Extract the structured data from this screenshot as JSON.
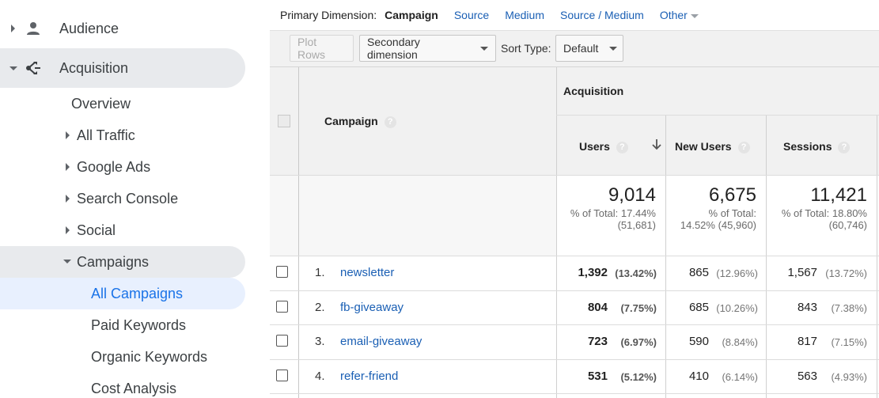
{
  "sidebar": {
    "audience": "Audience",
    "acquisition": "Acquisition",
    "overview": "Overview",
    "all_traffic": "All Traffic",
    "google_ads": "Google Ads",
    "search_console": "Search Console",
    "social": "Social",
    "campaigns": "Campaigns",
    "all_campaigns": "All Campaigns",
    "paid_keywords": "Paid Keywords",
    "organic_keywords": "Organic Keywords",
    "cost_analysis": "Cost Analysis"
  },
  "dimensions": {
    "label": "Primary Dimension:",
    "current": "Campaign",
    "source": "Source",
    "medium": "Medium",
    "source_medium": "Source / Medium",
    "other": "Other"
  },
  "toolbar": {
    "plot_rows": "Plot Rows",
    "secondary_dimension": "Secondary dimension",
    "sort_type_label": "Sort Type:",
    "sort_type_value": "Default"
  },
  "table": {
    "group_header": "Acquisition",
    "campaign_header": "Campaign",
    "columns": [
      "Users",
      "New Users",
      "Sessions"
    ],
    "help_glyph": "?",
    "totals": [
      {
        "value": "9,014",
        "pct_line1": "% of Total: 17.44%",
        "pct_line2": "(51,681)"
      },
      {
        "value": "6,675",
        "pct_line1": "% of Total:",
        "pct_line2": "14.52% (45,960)"
      },
      {
        "value": "11,421",
        "pct_line1": "% of Total: 18.80%",
        "pct_line2": "(60,746)"
      }
    ],
    "rows": [
      {
        "num": "1.",
        "name": "newsletter",
        "users": "1,392",
        "users_pct": "(13.42%)",
        "new_users": "865",
        "new_users_pct": "(12.96%)",
        "sessions": "1,567",
        "sessions_pct": "(13.72%)"
      },
      {
        "num": "2.",
        "name": "fb-giveaway",
        "users": "804",
        "users_pct": "(7.75%)",
        "new_users": "685",
        "new_users_pct": "(10.26%)",
        "sessions": "843",
        "sessions_pct": "(7.38%)"
      },
      {
        "num": "3.",
        "name": "email-giveaway",
        "users": "723",
        "users_pct": "(6.97%)",
        "new_users": "590",
        "new_users_pct": "(8.84%)",
        "sessions": "817",
        "sessions_pct": "(7.15%)"
      },
      {
        "num": "4.",
        "name": "refer-friend",
        "users": "531",
        "users_pct": "(5.12%)",
        "new_users": "410",
        "new_users_pct": "(6.14%)",
        "sessions": "563",
        "sessions_pct": "(4.93%)"
      }
    ]
  },
  "colors": {
    "link": "#1a5fb4",
    "active_nav": "#1a73e8",
    "active_nav_bg": "#e8f0fe",
    "section_bg": "#e8eaed"
  }
}
